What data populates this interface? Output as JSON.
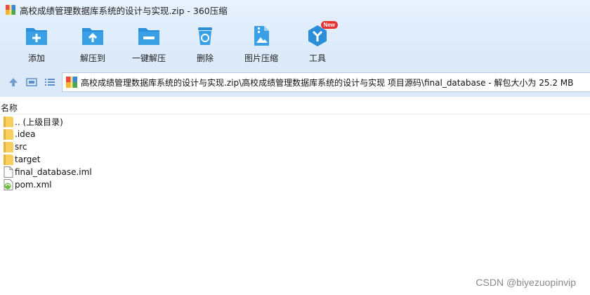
{
  "window": {
    "title": "高校成绩管理数据库系统的设计与实现.zip - 360压缩",
    "app_icon": "archive-icon"
  },
  "toolbar": {
    "items": [
      {
        "label": "添加",
        "icon": "add-icon"
      },
      {
        "label": "解压到",
        "icon": "extract-to-icon"
      },
      {
        "label": "一键解压",
        "icon": "one-click-extract-icon"
      },
      {
        "label": "删除",
        "icon": "delete-icon"
      },
      {
        "label": "图片压缩",
        "icon": "image-compress-icon"
      },
      {
        "label": "工具",
        "icon": "tools-icon",
        "badge": "New"
      }
    ]
  },
  "address": {
    "path": "高校成绩管理数据库系统的设计与实现.zip\\高校成绩管理数据库系统的设计与实现 项目源码\\final_database - 解包大小为 25.2 MB"
  },
  "columns": {
    "name": "名称"
  },
  "files": [
    {
      "name": ".. (上级目录)",
      "type": "folder"
    },
    {
      "name": ".idea",
      "type": "folder"
    },
    {
      "name": "src",
      "type": "folder"
    },
    {
      "name": "target",
      "type": "folder"
    },
    {
      "name": "final_database.iml",
      "type": "file"
    },
    {
      "name": "pom.xml",
      "type": "xml"
    }
  ],
  "watermark": "CSDN @biyezuopinvip",
  "colors": {
    "toolbar_bg": "#dbe9f9",
    "icon_blue": "#2a8fd8",
    "folder_yellow": "#f7cf5d",
    "badge_red": "#e8312f"
  }
}
